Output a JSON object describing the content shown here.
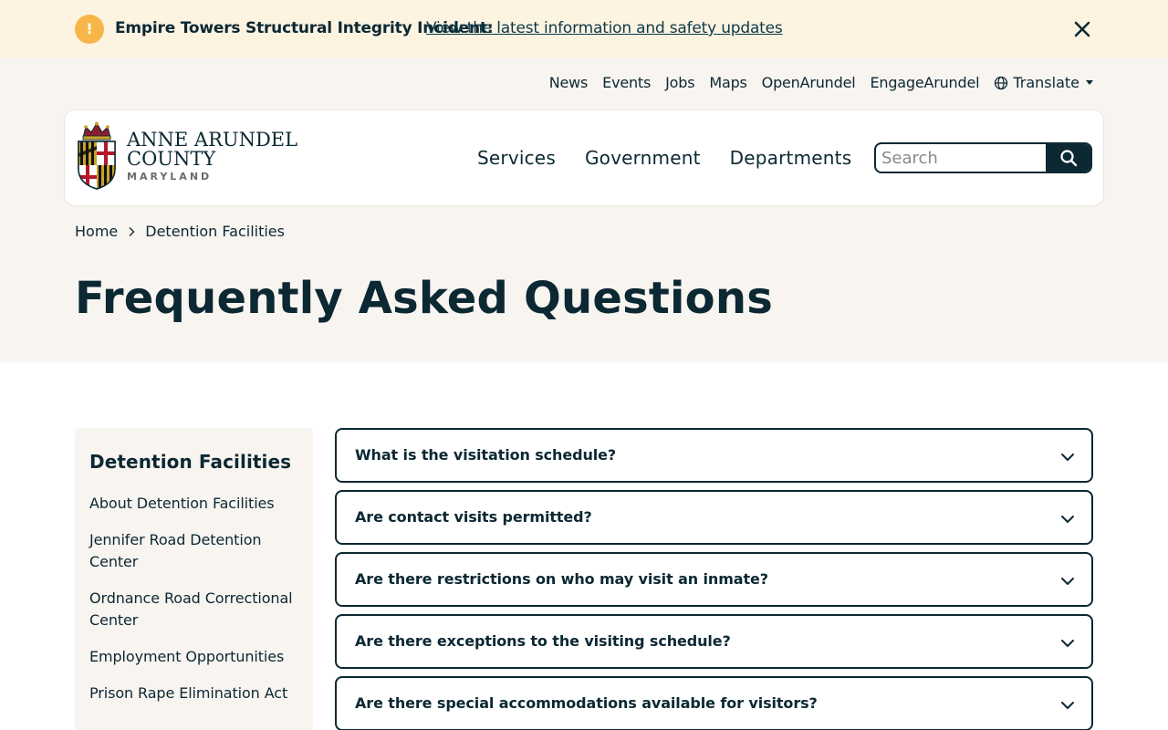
{
  "alert": {
    "icon": "exclamation-icon",
    "icon_glyph": "!",
    "title": "Empire Towers Structural Integrity Incident:",
    "link_text": "View the latest information and safety updates",
    "close_icon": "close-icon"
  },
  "utility_nav": {
    "items": [
      "News",
      "Events",
      "Jobs",
      "Maps",
      "OpenArundel",
      "EngageArundel"
    ],
    "translate_label": "Translate"
  },
  "logo": {
    "line1": "ANNE ARUNDEL",
    "line2": "COUNTY",
    "line3": "MARYLAND"
  },
  "main_nav": {
    "items": [
      "Services",
      "Government",
      "Departments"
    ]
  },
  "search": {
    "placeholder": "Search",
    "value": ""
  },
  "breadcrumb": {
    "home": "Home",
    "current": "Detention Facilities"
  },
  "page_title": "Frequently Asked Questions",
  "sidebar": {
    "title": "Detention Facilities",
    "items": [
      "About Detention Facilities",
      "Jennifer Road Detention Center",
      "Ordnance Road Correctional Center",
      "Employment Opportunities",
      "Prison Rape Elimination Act"
    ]
  },
  "faq": {
    "items": [
      "What is the visitation schedule?",
      "Are contact visits permitted?",
      "Are there restrictions on who may visit an inmate?",
      "Are there exceptions to the visiting schedule?",
      "Are there special accommodations available for visitors?"
    ]
  },
  "colors": {
    "brand_navy": "#0b2833",
    "alert_bg": "#fdf3e1",
    "alert_icon": "#f8b549",
    "header_bg": "#f8f4f0"
  }
}
